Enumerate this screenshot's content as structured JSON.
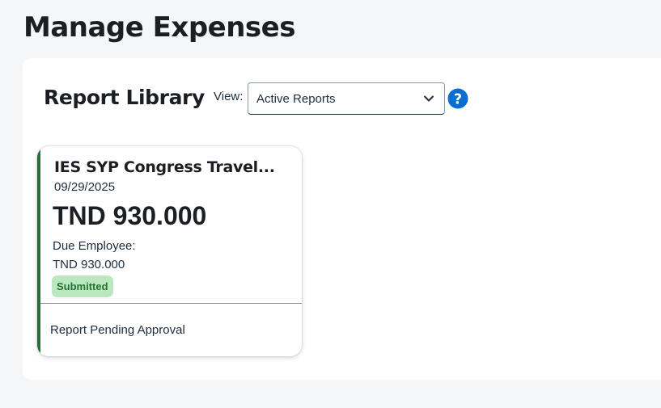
{
  "page": {
    "title": "Manage Expenses"
  },
  "report_library": {
    "title": "Report Library",
    "view_label": "View:",
    "view_selected": "Active Reports",
    "help_icon": "question-circle-icon"
  },
  "reports": [
    {
      "name": "IES SYP Congress Travel...",
      "date": "09/29/2025",
      "amount": "TND 930.000",
      "due_label": "Due Employee:",
      "due_value": "TND 930.000",
      "status": "Submitted",
      "footer": "Report Pending Approval"
    }
  ],
  "colors": {
    "accent_green": "#256f3a",
    "badge_bg": "#bae8bc",
    "help_blue": "#0a6ed1"
  }
}
